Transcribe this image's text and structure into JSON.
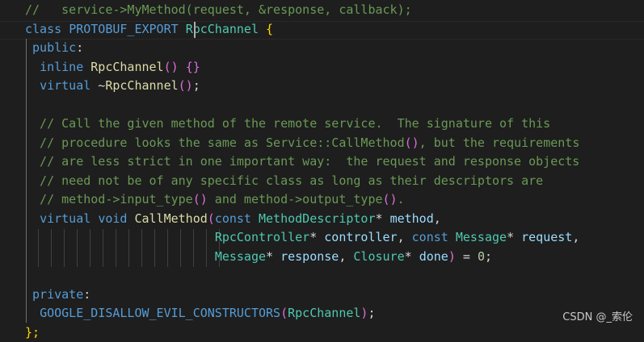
{
  "editor": {
    "lines": [
      [
        [
          "c-comment",
          "//   service->MyMethod(request, &response, callback);"
        ]
      ],
      [
        [
          "c-kw",
          "class"
        ],
        [
          "c-plain",
          " "
        ],
        [
          "c-macro",
          "PROTOBUF_EXPORT"
        ],
        [
          "c-plain",
          " "
        ],
        [
          "c-type",
          "RpcChannel"
        ],
        [
          "c-plain",
          " "
        ],
        [
          "c-brace",
          "{"
        ]
      ],
      [
        [
          "c-kw",
          " public"
        ],
        [
          "c-plain",
          ":"
        ]
      ],
      [
        [
          "c-plain",
          "  "
        ],
        [
          "c-kw",
          "inline"
        ],
        [
          "c-plain",
          " "
        ],
        [
          "c-fn",
          "RpcChannel"
        ],
        [
          "c-paren",
          "()"
        ],
        [
          "c-plain",
          " "
        ],
        [
          "c-paren",
          "{}"
        ]
      ],
      [
        [
          "c-plain",
          "  "
        ],
        [
          "c-kw",
          "virtual"
        ],
        [
          "c-plain",
          " ~"
        ],
        [
          "c-fn",
          "RpcChannel"
        ],
        [
          "c-paren",
          "()"
        ],
        [
          "c-plain",
          ";"
        ]
      ],
      [
        [
          "c-plain",
          ""
        ]
      ],
      [
        [
          "c-comment",
          "  // Call the given method of the remote service.  The signature of this"
        ]
      ],
      [
        [
          "c-comment",
          "  // procedure looks the same as Service::CallMethod"
        ],
        [
          "c-paren",
          "()"
        ],
        [
          "c-comment",
          ", but the requirements"
        ]
      ],
      [
        [
          "c-comment",
          "  // are less strict in one important way:  the request and response objects"
        ]
      ],
      [
        [
          "c-comment",
          "  // need not be of any specific class as long as their descriptors are"
        ]
      ],
      [
        [
          "c-comment",
          "  // method->input_type"
        ],
        [
          "c-paren",
          "()"
        ],
        [
          "c-comment",
          " and method->output_type"
        ],
        [
          "c-paren",
          "()"
        ],
        [
          "c-comment",
          "."
        ]
      ],
      [
        [
          "c-plain",
          "  "
        ],
        [
          "c-kw",
          "virtual"
        ],
        [
          "c-plain",
          " "
        ],
        [
          "c-kw",
          "void"
        ],
        [
          "c-plain",
          " "
        ],
        [
          "c-fn",
          "CallMethod"
        ],
        [
          "c-paren",
          "("
        ],
        [
          "c-kw",
          "const"
        ],
        [
          "c-plain",
          " "
        ],
        [
          "c-type",
          "MethodDescriptor"
        ],
        [
          "c-plain",
          "* "
        ],
        [
          "c-var",
          "method"
        ],
        [
          "c-plain",
          ","
        ]
      ],
      [
        [
          "c-plain",
          "                          "
        ],
        [
          "c-type",
          "RpcController"
        ],
        [
          "c-plain",
          "* "
        ],
        [
          "c-var",
          "controller"
        ],
        [
          "c-plain",
          ", "
        ],
        [
          "c-kw",
          "const"
        ],
        [
          "c-plain",
          " "
        ],
        [
          "c-type",
          "Message"
        ],
        [
          "c-plain",
          "* "
        ],
        [
          "c-var",
          "request"
        ],
        [
          "c-plain",
          ","
        ]
      ],
      [
        [
          "c-plain",
          "                          "
        ],
        [
          "c-type",
          "Message"
        ],
        [
          "c-plain",
          "* "
        ],
        [
          "c-var",
          "response"
        ],
        [
          "c-plain",
          ", "
        ],
        [
          "c-type",
          "Closure"
        ],
        [
          "c-plain",
          "* "
        ],
        [
          "c-var",
          "done"
        ],
        [
          "c-paren",
          ")"
        ],
        [
          "c-plain",
          " = "
        ],
        [
          "c-num",
          "0"
        ],
        [
          "c-plain",
          ";"
        ]
      ],
      [
        [
          "c-plain",
          ""
        ]
      ],
      [
        [
          "c-kw",
          " private"
        ],
        [
          "c-plain",
          ":"
        ]
      ],
      [
        [
          "c-plain",
          "  "
        ],
        [
          "c-macro",
          "GOOGLE_DISALLOW_EVIL_CONSTRUCTORS"
        ],
        [
          "c-paren",
          "("
        ],
        [
          "c-type",
          "RpcChannel"
        ],
        [
          "c-paren",
          ")"
        ],
        [
          "c-plain",
          ";"
        ]
      ],
      [
        [
          "c-brace",
          "};"
        ]
      ]
    ]
  },
  "watermark": {
    "text": "CSDN @_索伦"
  },
  "colors": {
    "background": "#1e1e1e",
    "comment": "#6a9955",
    "keyword": "#569cd6",
    "type": "#4ec9b0",
    "function": "#dcdcaa",
    "variable": "#9cdcfe"
  }
}
